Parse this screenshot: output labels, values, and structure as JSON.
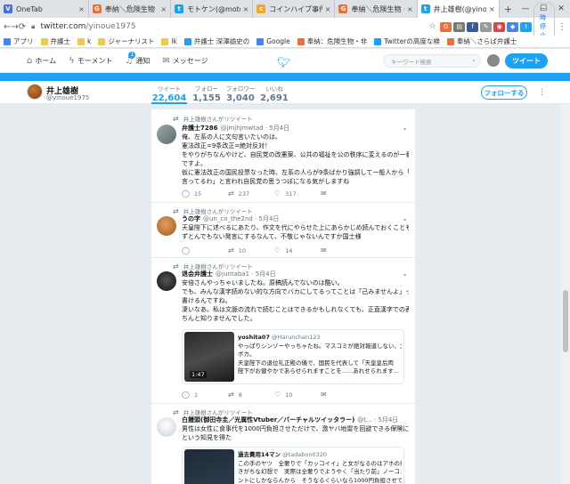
{
  "browser": {
    "tabs": [
      {
        "label": "OneTab",
        "favicon_color": "#4a6ee0",
        "glyph": "V",
        "active": false
      },
      {
        "label": "奉納＼危険生物・非",
        "favicon_color": "#e8713c",
        "glyph": "G",
        "active": false
      },
      {
        "label": "モトケン(@motoken",
        "favicon_color": "#1da1f2",
        "glyph": "t",
        "active": false
      },
      {
        "label": "コインハイブ事件 ·",
        "favicon_color": "#f5a623",
        "glyph": "c",
        "active": false
      },
      {
        "label": "奉納＼危険生物・非",
        "favicon_color": "#e8713c",
        "glyph": "G",
        "active": false
      },
      {
        "label": "井上雄樹(@yinoue",
        "favicon_color": "#1da1f2",
        "glyph": "t",
        "active": true
      }
    ],
    "new_tab": "+",
    "url_host": "twitter.com",
    "url_path": "/yinoue1975",
    "pause_label": "一時停止中",
    "bookmarks": [
      {
        "label": "アプリ",
        "color": "#4285f4"
      },
      {
        "label": "弁護士",
        "color": "#f2c94c"
      },
      {
        "label": "k",
        "color": "#f2c94c"
      },
      {
        "label": "ジャーナリスト",
        "color": "#f2c94c"
      },
      {
        "label": "lk",
        "color": "#f2c94c"
      },
      {
        "label": "弁護士 深澤諭史の",
        "color": "#1da1f2"
      },
      {
        "label": "Google",
        "color": "#4285f4"
      },
      {
        "label": "奉納：危険生物・非",
        "color": "#e8713c"
      },
      {
        "label": "Twitterの高度な検",
        "color": "#1da1f2"
      },
      {
        "label": "奉納＼さらば弁護士",
        "color": "#e8713c"
      }
    ]
  },
  "twitter_nav": {
    "home": "ホーム",
    "moments": "モーメント",
    "notifications": "通知",
    "notifications_badge": "1",
    "messages": "メッセージ",
    "search_placeholder": "キーワード検索",
    "tweet_button": "ツイート"
  },
  "profile": {
    "name": "井上雄樹",
    "handle": "@yinoue1975",
    "stats": [
      {
        "label": "ツイート",
        "value": "22,604",
        "active": true
      },
      {
        "label": "フォロー",
        "value": "1,155",
        "active": false
      },
      {
        "label": "フォロワー",
        "value": "3,040",
        "active": false
      },
      {
        "label": "いいね",
        "value": "2,691",
        "active": false
      }
    ],
    "follow_button": "フォローする"
  },
  "tweets": [
    {
      "retweeted_by": "井上雄樹さんがリツイート",
      "display_name": "弁護士7286",
      "handle_time": "@jmjhjmwtad · 5月4日",
      "avatar_color": "#7a8b8c",
      "lines": [
        "俺、左系の人に文句言いたいのは、",
        "憲法改正=9条改正=絶対反対！",
        "をやりがちなんやけど、自民党の改憲案、公共の福祉を公の秩序に変えるのが一番ヤバいん",
        "ですよ。",
        "仮に憲法改正の国民投票なった時、左系の人らが9条ばかり強調して一般人から「また",
        "言ってるわ」と言われ自民党の思うつぼになる気がしますね"
      ],
      "replies": "15",
      "retweets": "237",
      "likes": "317"
    },
    {
      "retweeted_by": "井上雄樹さんがリツイート",
      "display_name": "うの字",
      "handle_time": "@un_co_the2nd · 5月4日",
      "avatar_color": "#c8772e",
      "lines": [
        "天皇陛下に述べるにあたり、作文を代にやらせた上にあらかじめ読んでおくこともしな",
        "ずとんでもない発言にするなんて、不敬じゃないんですか国士様"
      ],
      "replies": "",
      "retweets": "10",
      "likes": "14"
    },
    {
      "retweeted_by": "井上雄樹さんがリツイート",
      "display_name": "退会弁護士",
      "handle_time": "@juntaba1 · 5月4日",
      "avatar_color": "#2c2c2c",
      "lines": [
        "安倍さんやっちゃいましたね。原稿読んでないのは酷い。",
        "でも、みんな漢字読めない的な方向でバカにしてるってことは「己みませんよ」って漢字で",
        "書けるんですね。",
        "凄いなあ。私は文脈の流れで読むことはできるかもしれなくても、正直漢字での表記をき",
        "ちんと知りませんでした。"
      ],
      "quote": {
        "name": "yoshita07",
        "handle": "@Harunchan123",
        "duration": "1:47",
        "lines": [
          "やっぱりシンゾーやっちゃたね。マスコミが絶対報道しない、大",
          "ボカ。",
          "天皇陛下の退位礼正殿の儀で、国民を代表して「天皇皇后両",
          "陛下がお健やかであらせられますことを......あれせられます..."
        ]
      },
      "replies": "1",
      "retweets": "8",
      "likes": "10"
    },
    {
      "retweeted_by": "井上雄樹さんがリツイート",
      "display_name": "白饅頭(御田寺圭／光属性Vtuber／バーチャルツイッタラー)",
      "handle_time": "@t... · 5月4日",
      "avatar_color": "#d8dde3",
      "lines": [
        "男性は女性に食事代を1000円負担させただけで、激ヤバ地雷を回避できる保険になるか",
        "という知見を得た"
      ],
      "quote": {
        "name": "過去費用14マン",
        "handle": "@tadabon0320",
        "duration": "",
        "lines": [
          "この手のヤツ　全奢りで「カッコイイ」と女がなるのはアホの煎",
          "きがちな幻想で　実際は全奢りでようやく「当たり前」ノーコメ",
          "ントにしかならんから　そうなるぐらいなら1000円負担させて"
        ]
      }
    }
  ]
}
